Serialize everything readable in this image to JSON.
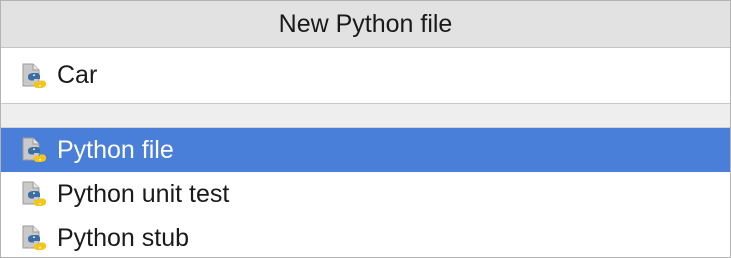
{
  "dialog": {
    "title": "New Python file",
    "name_field": {
      "value": "Car",
      "icon": "python-file-icon"
    },
    "kinds": [
      {
        "label": "Python file",
        "icon": "python-file-icon",
        "selected": true
      },
      {
        "label": "Python unit test",
        "icon": "python-file-icon",
        "selected": false
      },
      {
        "label": "Python stub",
        "icon": "python-file-icon",
        "selected": false
      }
    ]
  },
  "colors": {
    "title_bar_bg": "#e2e2e2",
    "selection_bg": "#4a7fd9",
    "python_blue": "#3a6ea5",
    "python_yellow": "#f5c518"
  }
}
